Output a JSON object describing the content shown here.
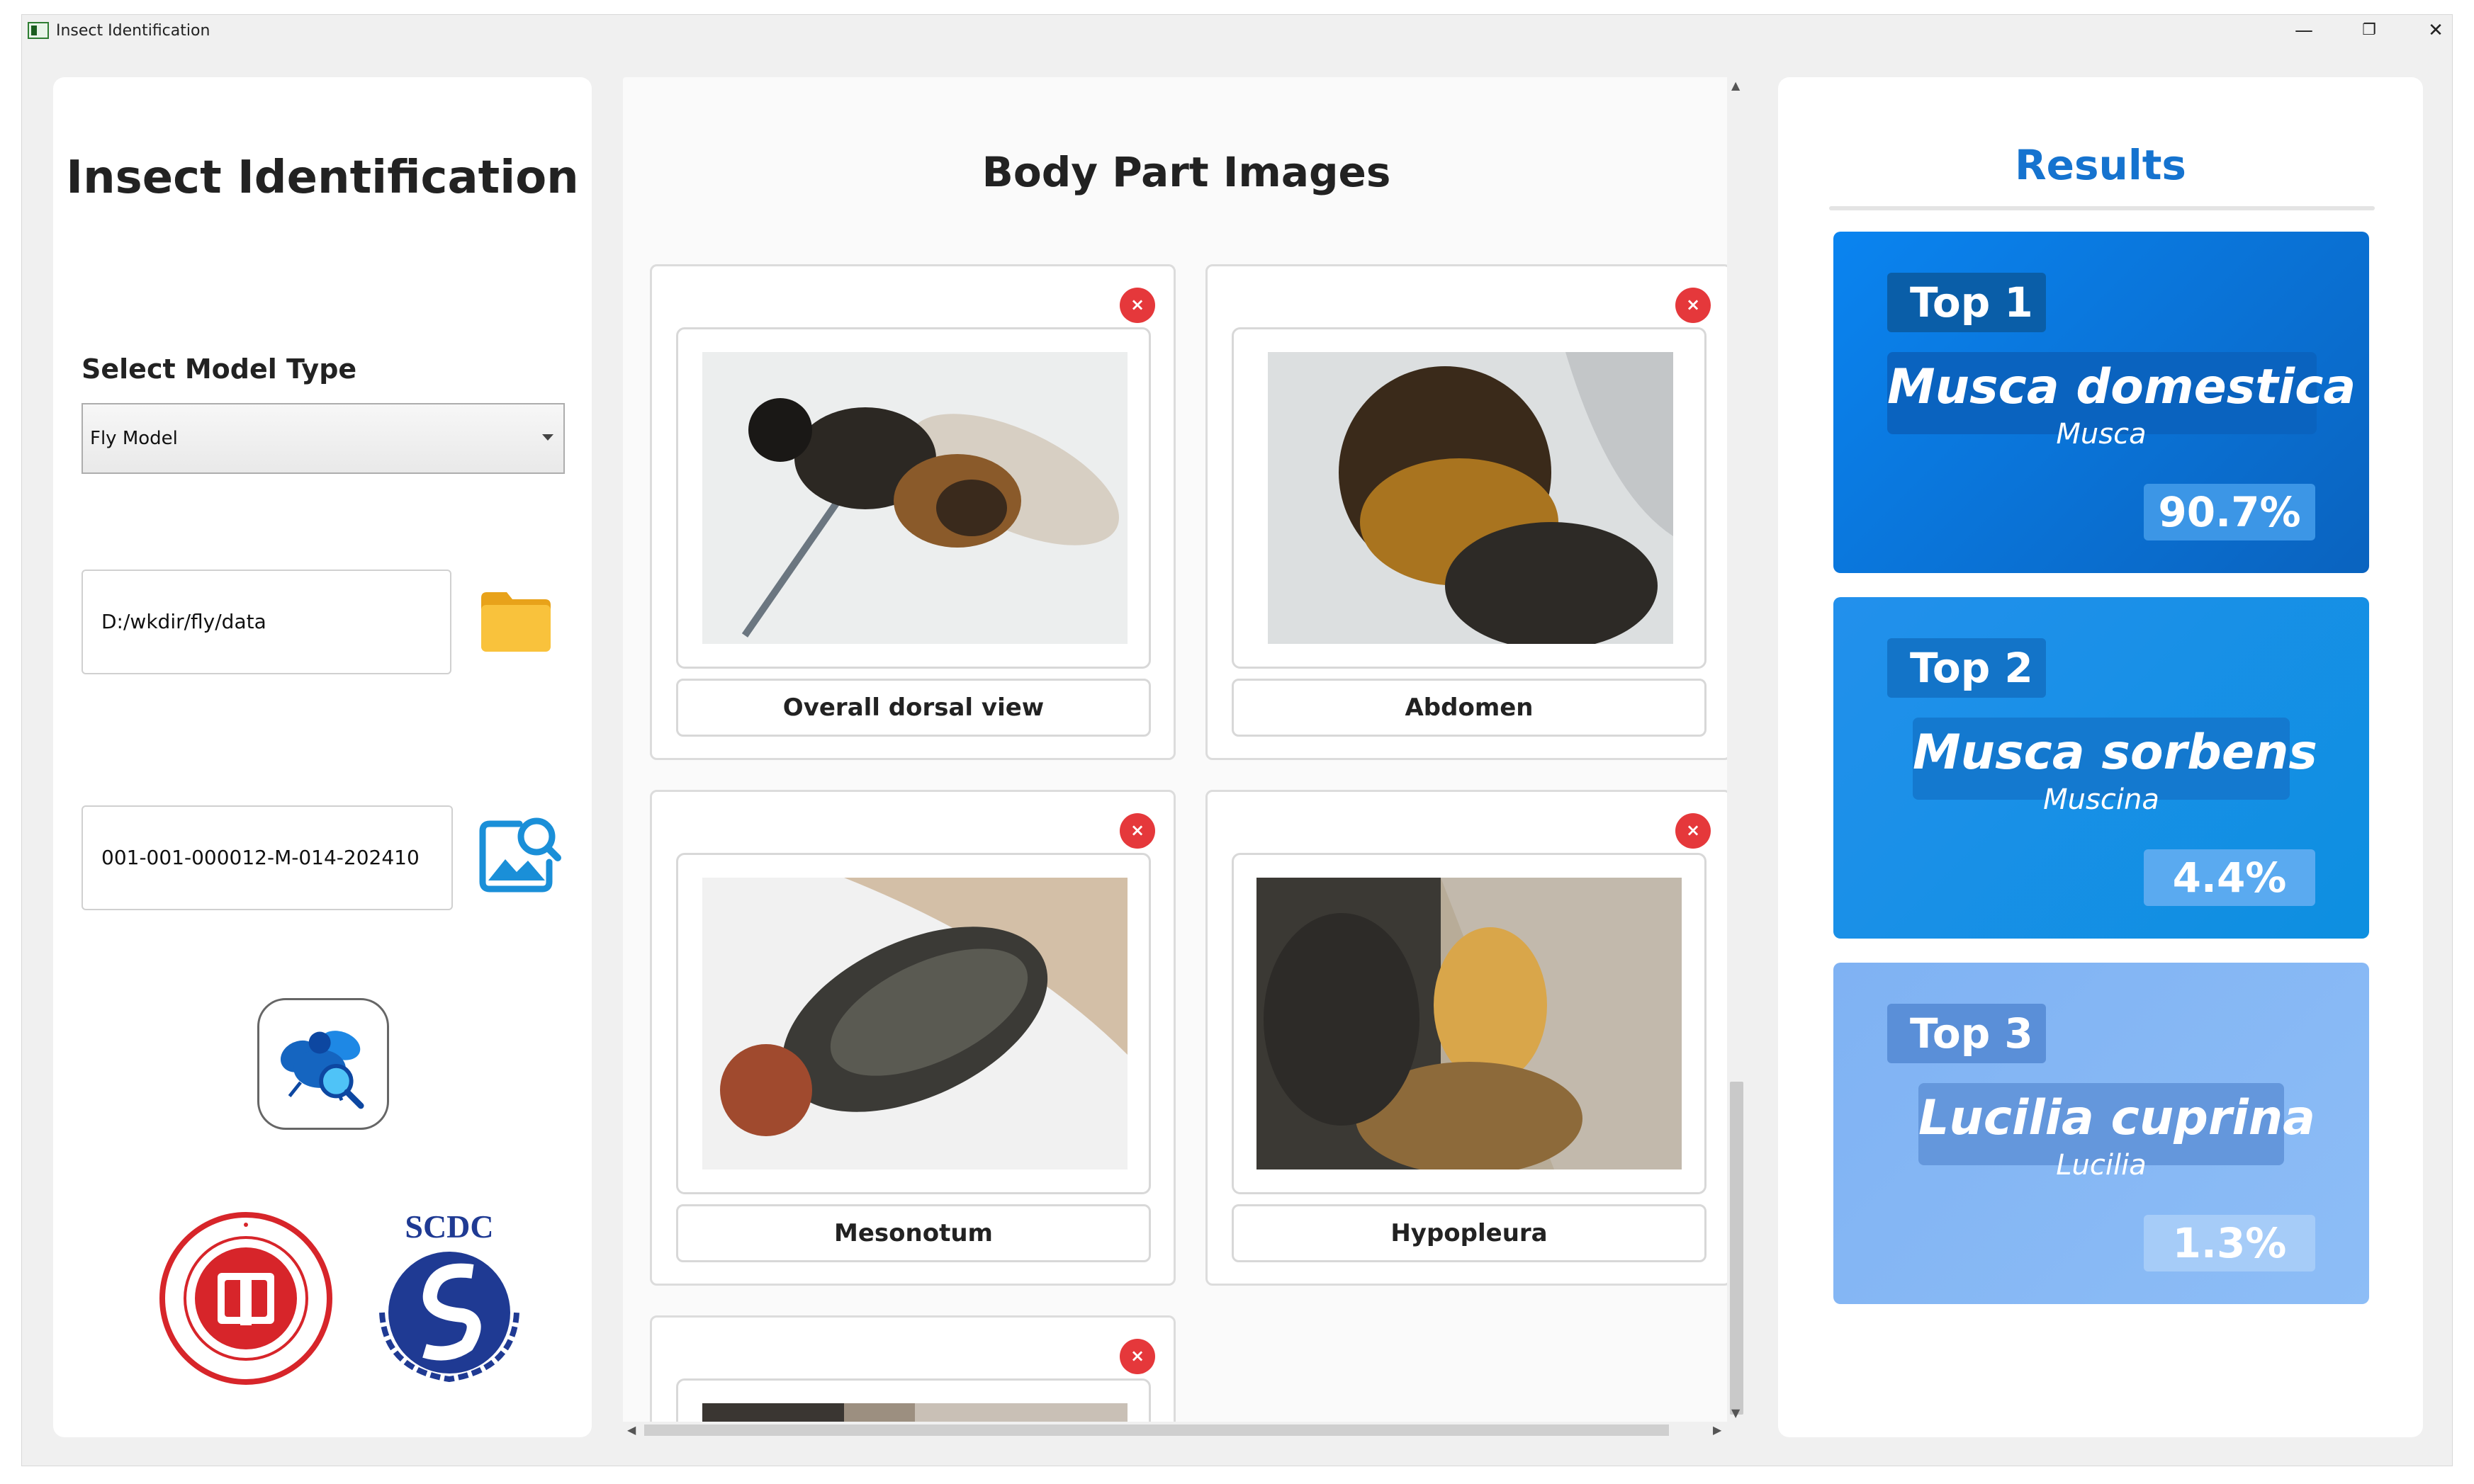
{
  "window": {
    "title": "Insect Identification",
    "minimize_glyph": "—",
    "restore_glyph": "❐",
    "close_glyph": "✕"
  },
  "left": {
    "title": "Insect Identification",
    "model_label": "Select Model Type",
    "model_value": "Fly Model",
    "path_value": "D:/wkdir/fly/data",
    "sample_id_value": "001-001-000012-M-014-202410",
    "logos": [
      "University of Shanghai for Science and Technology seal",
      "SCDC"
    ],
    "scdc_text": "SCDC"
  },
  "center": {
    "title": "Body Part Images",
    "cards": [
      {
        "label": "Overall dorsal view",
        "close": "×"
      },
      {
        "label": "Abdomen",
        "close": "×"
      },
      {
        "label": "Mesonotum",
        "close": "×"
      },
      {
        "label": "Hypopleura",
        "close": "×"
      },
      {
        "label": "",
        "close": "×"
      }
    ]
  },
  "results": {
    "title": "Results",
    "items": [
      {
        "rank": "Top 1",
        "species": "Musca domestica",
        "genus": "Musca",
        "percent": "90.7%",
        "confidence": 0.907,
        "color": "#0a78e0"
      },
      {
        "rank": "Top 2",
        "species": "Musca sorbens",
        "genus": "Muscina",
        "percent": "4.4%",
        "confidence": 0.044,
        "color": "#2a93ec"
      },
      {
        "rank": "Top 3",
        "species": "Lucilia cuprina",
        "genus": "Lucilia",
        "percent": "1.3%",
        "confidence": 0.013,
        "color": "#82b6f4"
      }
    ]
  },
  "colors": {
    "accent": "#1573cf",
    "close": "#e5383b",
    "folder": "#f9b826"
  }
}
